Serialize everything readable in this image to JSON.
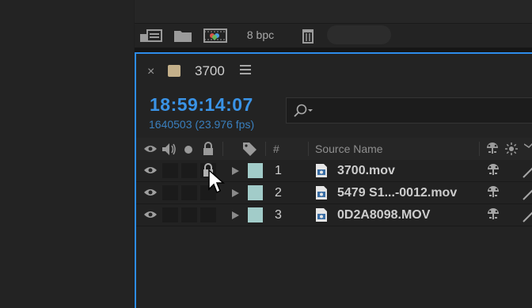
{
  "project_toolbar": {
    "bit_depth": "8 bpc",
    "icons": [
      "interpret-footage-icon",
      "new-folder-icon",
      "new-composition-icon",
      "trash-icon"
    ]
  },
  "timeline": {
    "tab": {
      "close": "×",
      "comp_name": "3700",
      "swatch_color": "#c4b08a"
    },
    "timecode": "18:59:14:07",
    "frame_info": "1640503 (23.976 fps)",
    "search": {
      "placeholder": "",
      "icon": "search-icon"
    },
    "columns": {
      "visibility": "eye-icon",
      "audio": "speaker-icon",
      "solo": "solo-dot-icon",
      "lock": "lock-icon",
      "label": "label-tag-icon",
      "number": "#",
      "source_name": "Source Name",
      "switches": [
        "shy-icon",
        "collapse-sun-icon"
      ]
    },
    "layers": [
      {
        "number": "1",
        "name": "3700.mov",
        "label_color": "#a2ccc9",
        "locked": true
      },
      {
        "number": "2",
        "name": "5479 S1...-0012.mov",
        "label_color": "#a2ccc9",
        "locked": false
      },
      {
        "number": "3",
        "name": "0D2A8098.MOV",
        "label_color": "#a2ccc9",
        "locked": false
      }
    ]
  }
}
